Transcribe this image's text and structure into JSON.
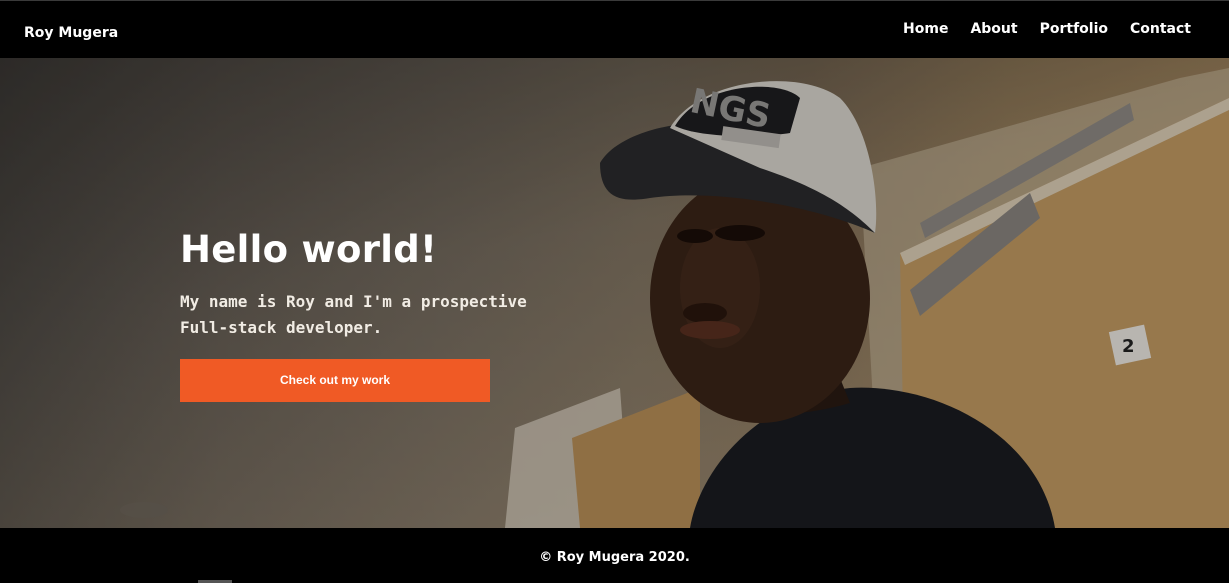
{
  "navbar": {
    "brand": "Roy Mugera",
    "links": [
      {
        "label": "Home"
      },
      {
        "label": "About"
      },
      {
        "label": "Portfolio"
      },
      {
        "label": "Contact"
      }
    ]
  },
  "hero": {
    "title": "Hello world!",
    "subtitle": "My name is Roy and I'm a prospective Full-stack developer.",
    "cta_label": "Check out my work",
    "door_number": "2"
  },
  "footer": {
    "text": "© Roy Mugera 2020."
  },
  "colors": {
    "navbar_bg": "#000000",
    "accent": "#f05a25",
    "text": "#ffffff"
  }
}
